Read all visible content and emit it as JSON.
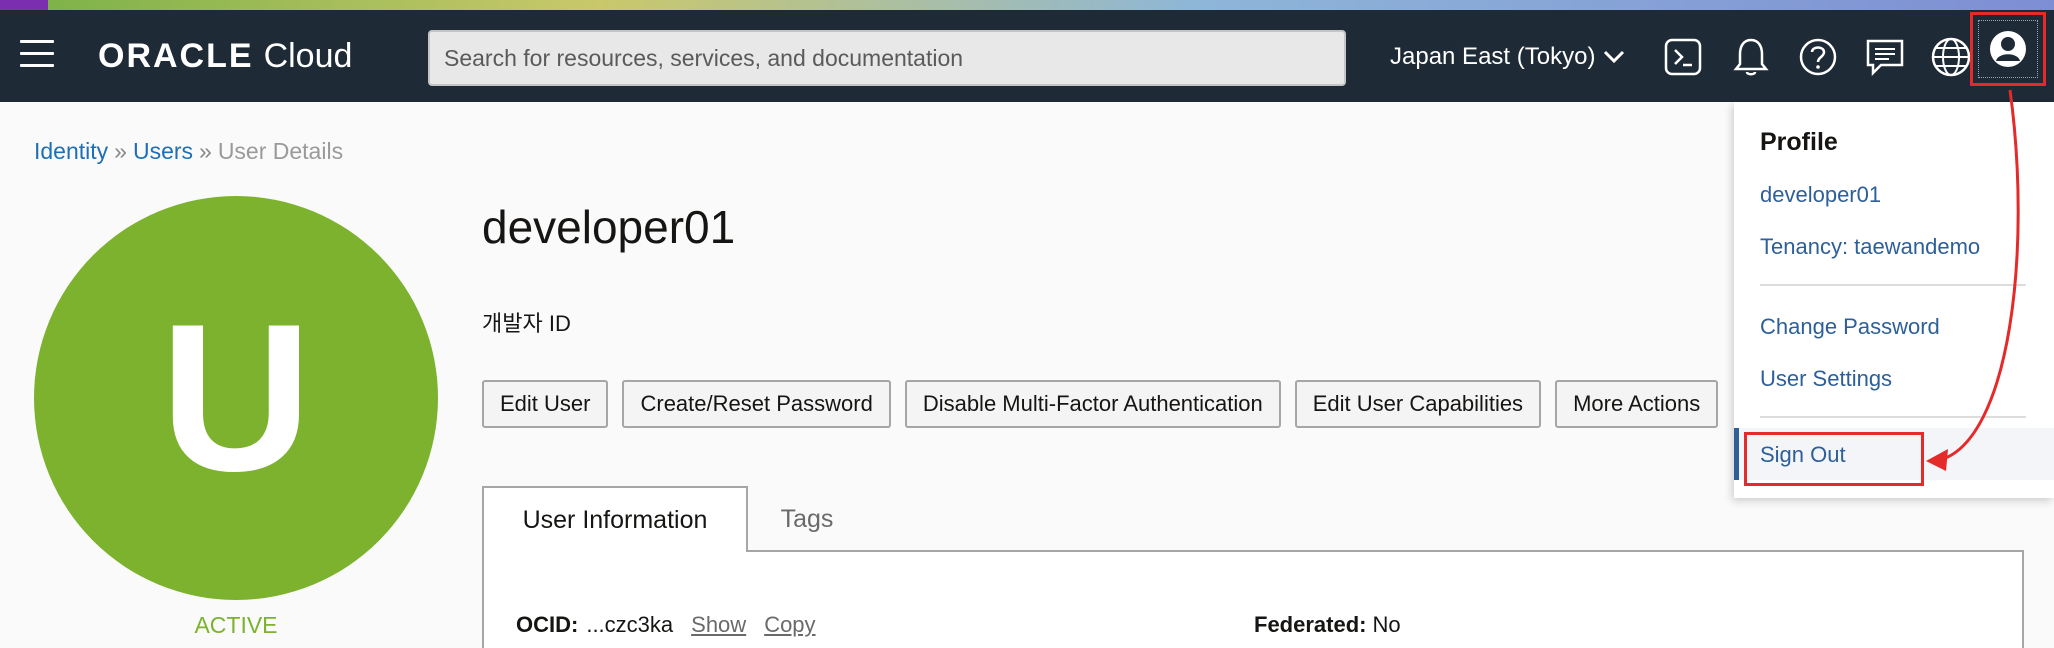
{
  "header": {
    "logo_oracle": "ORACLE",
    "logo_cloud": "Cloud",
    "search_placeholder": "Search for resources, services, and documentation",
    "region": "Japan East (Tokyo)",
    "icons": [
      "menu-icon",
      "cloud-shell-icon",
      "bell-icon",
      "help-icon",
      "chat-icon",
      "globe-icon",
      "user-profile-icon"
    ]
  },
  "breadcrumb": {
    "identity": "Identity",
    "sep": "»",
    "users": "Users",
    "current": "User Details"
  },
  "avatar": {
    "letter": "U",
    "status": "ACTIVE",
    "color": "#7cb22e"
  },
  "user": {
    "name": "developer01",
    "description": "개발자 ID"
  },
  "actions": [
    "Edit User",
    "Create/Reset Password",
    "Disable Multi-Factor Authentication",
    "Edit User Capabilities",
    "More Actions"
  ],
  "tabs": {
    "active": "User Information",
    "other": "Tags"
  },
  "info": {
    "ocid_label": "OCID:",
    "ocid_value": "...czc3ka",
    "show": "Show",
    "copy": "Copy",
    "federated_label": "Federated:",
    "federated_value": "No"
  },
  "dropdown": {
    "title": "Profile",
    "username": "developer01",
    "tenancy": "Tenancy: taewandemo",
    "change_password": "Change Password",
    "user_settings": "User Settings",
    "sign_out": "Sign Out"
  },
  "colors": {
    "header_bg": "#1e2a36",
    "link": "#1f6fb5",
    "highlight": "#e52a2a"
  }
}
